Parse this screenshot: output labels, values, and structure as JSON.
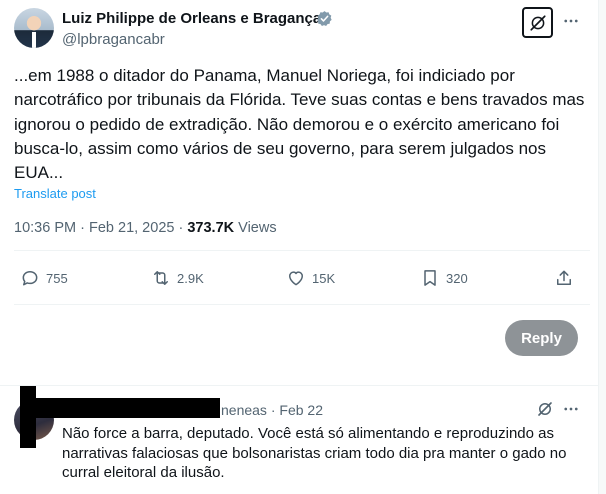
{
  "post": {
    "author_name": "Luiz Philippe de Orleans e Bragança",
    "handle": "@lpbragancabr",
    "text": "...em 1988 o ditador do Panama, Manuel Noriega, foi indiciado por narcotráfico por tribunais da Flórida. Teve suas contas e bens travados mas ignorou o pedido de extradição. Não demorou e o exército americano foi busca-lo, assim como vários de seu governo, para serem julgados nos EUA...",
    "translate_label": "Translate post",
    "time": "10:36 PM",
    "separator": "·",
    "date": "Feb 21, 2025",
    "views_count": "373.7K",
    "views_label": "Views",
    "icons": {
      "verified": "verified-badge-icon",
      "grok": "grok-icon",
      "more": "more-icon"
    }
  },
  "actions": {
    "replies": "755",
    "reposts": "2.9K",
    "likes": "15K",
    "bookmarks": "320"
  },
  "reply_button_label": "Reply",
  "reply": {
    "author_fragment": "neneas",
    "separator": "·",
    "date": "Feb 22",
    "text": "Não force a barra, deputado. Você está só alimentando e reproduzindo as narrativas falaciosas que bolsonaristas criam todo dia pra manter o gado no curral eleitoral da ilusão."
  },
  "colors": {
    "text": "#0f1419",
    "secondary": "#536471",
    "link": "#1d9bf0",
    "verified": "#829aab",
    "reply_button": "#8e9397",
    "divider": "#eff3f4"
  }
}
